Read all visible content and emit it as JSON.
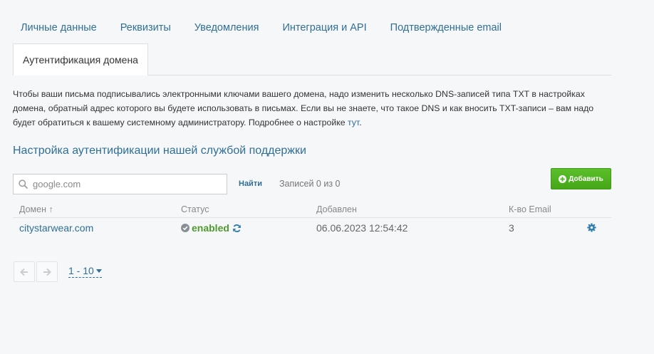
{
  "tabs": [
    {
      "label": "Личные данные"
    },
    {
      "label": "Реквизиты"
    },
    {
      "label": "Уведомления"
    },
    {
      "label": "Интеграция и API"
    },
    {
      "label": "Подтвержденные email"
    }
  ],
  "active_tab": {
    "label": "Аутентификация домена"
  },
  "description": {
    "text": "Чтобы ваши письма подписывались электронными ключами вашего домена, надо изменить несколько DNS-записей типа TXT в настройках домена, обратный адрес которого вы будете использовать в письмах. Если вы не знаете, что такое DNS и как вносить TXT-записи – вам надо будет обратиться к вашему системному администратору. Подробнее о настройке ",
    "link": "тут",
    "end": "."
  },
  "section_title": "Настройка аутентификации нашей службой поддержки",
  "search": {
    "placeholder": "google.com",
    "value": "",
    "icon": "search-icon"
  },
  "find_label": "Найти",
  "records_label": "Записей 0 из 0",
  "add_button": {
    "label": "Добавить",
    "icon": "plus-circle-icon",
    "color": "#4fb520"
  },
  "table": {
    "headers": {
      "domain": "Домен",
      "sort_icon": "↑",
      "status": "Статус",
      "added": "Добавлен",
      "count": "К-во Email"
    },
    "rows": [
      {
        "domain": "citystarwear.com",
        "status": "enabled",
        "added": "06.06.2023 12:54:42",
        "count": "3"
      }
    ]
  },
  "pagination": {
    "page_size": "1 - 10"
  },
  "colors": {
    "link": "#2f6f95",
    "success": "#4f9a2e",
    "background": "#f6f7f9"
  }
}
